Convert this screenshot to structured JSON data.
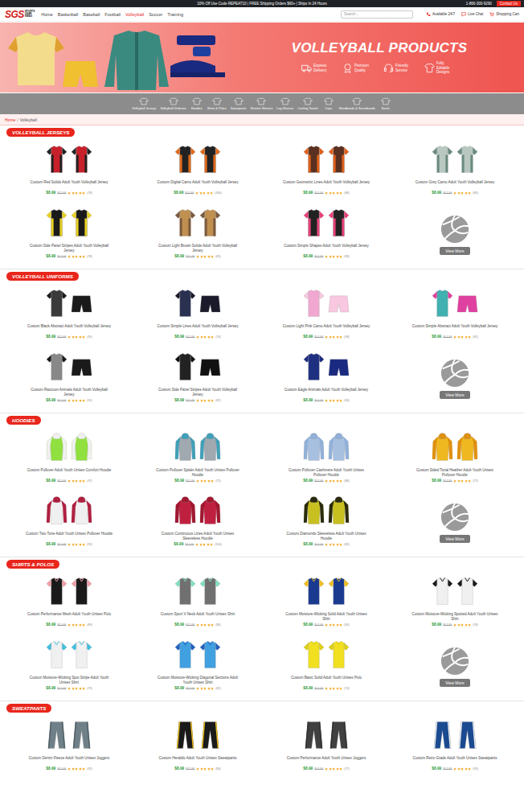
{
  "promo_bar": {
    "message": "10% Off Use Code REPEAT10 | FREE Shipping Orders $60+ | Ships In 24 Hours",
    "phone": "1-866-300-9290",
    "contact": "Contact Us"
  },
  "header": {
    "logo": "SGS",
    "logo_sub": [
      "SPORTS",
      "GEAR",
      "SWAG"
    ],
    "nav": [
      {
        "label": "Home",
        "selected": false
      },
      {
        "label": "Basketball",
        "selected": false
      },
      {
        "label": "Baseball",
        "selected": false
      },
      {
        "label": "Football",
        "selected": false
      },
      {
        "label": "Volleyball",
        "selected": true
      },
      {
        "label": "Soccer",
        "selected": false
      },
      {
        "label": "Training",
        "selected": false
      }
    ],
    "search": {
      "placeholder": "Search..."
    },
    "actions": [
      {
        "label": "Available 24/7",
        "kind": "phone"
      },
      {
        "label": "Live Chat",
        "kind": "chat"
      },
      {
        "label": "Shopping Cart",
        "kind": "cart"
      }
    ]
  },
  "banner": {
    "title": "VOLLEYBALL PRODUCTS",
    "features": [
      {
        "label": "Express Delivery",
        "kind": "truck"
      },
      {
        "label": "Premium Quality",
        "kind": "medal"
      },
      {
        "label": "Friendly Service",
        "kind": "headset"
      },
      {
        "label": "Fully Editable Designs",
        "kind": "shirt"
      }
    ]
  },
  "categories": [
    "Volleyball Jerseys",
    "Volleyball Uniforms",
    "Hoodies",
    "Shirts & Polos",
    "Sweatpants",
    "Shooter Sleeves",
    "Leg Sleeves",
    "Cooling Towels",
    "Caps",
    "Headbands & Sweatbands",
    "Socks"
  ],
  "breadcrumb": {
    "items": [
      "Home",
      "Volleyball"
    ],
    "separator": "/"
  },
  "sections": [
    {
      "title": "VOLLEYBALL JERSEYS",
      "kind": "jersey",
      "view_more": "View More",
      "products": [
        {
          "name": "Custom Red Solids Adult Youth Volleyball Jersey",
          "price": "$8.99",
          "old_price": "$17.99",
          "stars": 5,
          "reviews": "(78)",
          "color": "#c8202a",
          "trim": "#222222"
        },
        {
          "name": "Custom Digital Camo Adult Youth Volleyball Jersey",
          "price": "$8.99",
          "old_price": "$17.99",
          "stars": 5,
          "reviews": "(160)",
          "color": "#222222",
          "trim": "#e06a1a"
        },
        {
          "name": "Custom Geometric Lines Adult Youth Volleyball Jersey",
          "price": "$8.99",
          "old_price": "$17.99",
          "stars": 5,
          "reviews": "(88)",
          "color": "#5a3020",
          "trim": "#e0601a"
        },
        {
          "name": "Custom Grey Camo Adult Youth Volleyball Jersey",
          "price": "$8.99",
          "old_price": "$17.99",
          "stars": 5,
          "reviews": "(84)",
          "color": "#b8c8c0",
          "trim": "#6a8a80"
        },
        {
          "name": "Custom Side Panel Stripes Adult Youth Volleyball Jersey",
          "price": "$8.99",
          "old_price": "$17.99",
          "stars": 5,
          "reviews": "(78)",
          "color": "#1a1a1a",
          "trim": "#e8d020"
        },
        {
          "name": "Custom Light Brown Solids Adult Youth Volleyball Jersey",
          "price": "$8.99",
          "old_price": "$17.99",
          "stars": 5,
          "reviews": "(85)",
          "color": "#c09050",
          "trim": "#7a5a40"
        },
        {
          "name": "Custom Simple Shapes Adult Youth Volleyball Jersey",
          "price": "$8.99",
          "old_price": "$17.99",
          "stars": 5,
          "reviews": "(98)",
          "color": "#222222",
          "trim": "#e8407a"
        }
      ]
    },
    {
      "title": "VOLLEYBALL UNIFORMS",
      "kind": "uniform",
      "view_more": "View More",
      "products": [
        {
          "name": "Custom Black Abstract Adult Youth Volleyball Jersey",
          "price": "$8.99",
          "old_price": "$17.99",
          "stars": 5,
          "reviews": "(95)",
          "color": "#3a3a3a",
          "trim": "#1a1a1a"
        },
        {
          "name": "Custom Simple Lines Adult Youth Volleyball Jersey",
          "price": "$8.99",
          "old_price": "$17.99",
          "stars": 5,
          "reviews": "(70)",
          "color": "#2a3050",
          "trim": "#1a1a2a"
        },
        {
          "name": "Custom Light Pink Camo Adult Youth Volleyball Jersey",
          "price": "$8.99",
          "old_price": "$17.99",
          "stars": 5,
          "reviews": "(98)",
          "color": "#f0a8d0",
          "trim": "#f8c8e0"
        },
        {
          "name": "Custom Simple Abstract Adult Youth Volleyball Jersey",
          "price": "$8.99",
          "old_price": "$17.99",
          "stars": 5,
          "reviews": "(81)",
          "color": "#40b0b0",
          "trim": "#e040a0"
        },
        {
          "name": "Custom Raccoon Animals Adult Youth Volleyball Jersey",
          "price": "$8.99",
          "old_price": "$17.99",
          "stars": 5,
          "reviews": "(91)",
          "color": "#888888",
          "trim": "#1a1a1a"
        },
        {
          "name": "Custom Side Panel Stripes Adult Youth Volleyball Jersey",
          "price": "$8.99",
          "old_price": "$17.99",
          "stars": 5,
          "reviews": "(87)",
          "color": "#222222",
          "trim": "#111111"
        },
        {
          "name": "Custom Eagle Animals Adult Youth Volleyball Jersey",
          "price": "$8.99",
          "old_price": "$17.99",
          "stars": 5,
          "reviews": "(96)",
          "color": "#203080",
          "trim": "#1a2a80"
        }
      ]
    },
    {
      "title": "HOODIES",
      "kind": "hoodie",
      "view_more": "View More",
      "products": [
        {
          "name": "Custom Pullover Adult Youth Unisex Comfort Hoodie",
          "price": "$8.99",
          "old_price": "$17.99",
          "stars": 5,
          "reviews": "(97)",
          "color": "#90e040",
          "trim": "#f0f0f0"
        },
        {
          "name": "Custom Pullover Spider Adult Youth Unisex Pullover Hoodie",
          "price": "$8.99",
          "old_price": "$17.99",
          "stars": 5,
          "reviews": "(75)",
          "color": "#a0a8b0",
          "trim": "#40a0b8"
        },
        {
          "name": "Custom Pullover Cashmere Adult Youth Unisex Pullover Hoodie",
          "price": "$8.99",
          "old_price": "$17.99",
          "stars": 5,
          "reviews": "(88)",
          "color": "#a8c0e0",
          "trim": "#90b0d8"
        },
        {
          "name": "Custom Sided Tonal Heather Adult Youth Unisex Pullover Hoodie",
          "price": "$8.99",
          "old_price": "$17.99",
          "stars": 5,
          "reviews": "(71)",
          "color": "#f0b820",
          "trim": "#e09010"
        },
        {
          "name": "Custom Two-Tone Adult Youth Unisex Pullover Hoodie",
          "price": "$8.99",
          "old_price": "$17.99",
          "stars": 5,
          "reviews": "(95)",
          "color": "#f0f0f0",
          "trim": "#b02040"
        },
        {
          "name": "Custom Continuous Lines Adult Youth Unisex Sleeveless Hoodie",
          "price": "$8.99",
          "old_price": "$17.99",
          "stars": 5,
          "reviews": "(104)",
          "color": "#c02040",
          "trim": "#a01830"
        },
        {
          "name": "Custom Diamonds Sleeveless Adult Youth Unisex Hoodie",
          "price": "$8.99",
          "old_price": "$17.99",
          "stars": 5,
          "reviews": "(83)",
          "color": "#c8c020",
          "trim": "#2a2a10"
        }
      ]
    },
    {
      "title": "SHIRTS & POLOS",
      "kind": "shirt",
      "view_more": "View More",
      "products": [
        {
          "name": "Custom Performance Mesh Adult Youth Unisex Polo",
          "price": "$8.99",
          "old_price": "$17.99",
          "stars": 5,
          "reviews": "(89)",
          "color": "#1a1a1a",
          "trim": "#f0a0a8"
        },
        {
          "name": "Custom Sport V Neck Adult Youth Unisex Shirt",
          "price": "$8.99",
          "old_price": "$17.99",
          "stars": 5,
          "reviews": "(86)",
          "color": "#707070",
          "trim": "#80e0c0"
        },
        {
          "name": "Custom Moisture-Wicking Solid Adult Youth Unisex Shirt",
          "price": "$8.99",
          "old_price": "$17.99",
          "stars": 5,
          "reviews": "(90)",
          "color": "#1a3a90",
          "trim": "#f0c020"
        },
        {
          "name": "Custom Moisture-Wicking Spotted Adult Youth Unisex Shirt",
          "price": "$8.99",
          "old_price": "$17.99",
          "stars": 5,
          "reviews": "(78)",
          "color": "#f0f0f0",
          "trim": "#1a1a1a"
        },
        {
          "name": "Custom Moisture-Wicking Spot Stripe Adult Youth Unisex Shirt",
          "price": "$8.99",
          "old_price": "$17.99",
          "stars": 5,
          "reviews": "(79)",
          "color": "#f0f0f0",
          "trim": "#40c0e0"
        },
        {
          "name": "Custom Moisture-Wicking Diagonal Sections Adult Youth Unisex Shirt",
          "price": "$8.99",
          "old_price": "$17.99",
          "stars": 5,
          "reviews": "(82)",
          "color": "#40a0e0",
          "trim": "#2060c0"
        },
        {
          "name": "Custom Basic Solid Adult Youth Unisex Polo",
          "price": "$8.99",
          "old_price": "$17.99",
          "stars": 5,
          "reviews": "(74)",
          "color": "#f0e020",
          "trim": "#e0d010"
        }
      ]
    },
    {
      "title": "SWEATPANTS",
      "kind": "pants",
      "view_more": "",
      "products": [
        {
          "name": "Custom Denim Fleece Adult Youth Unisex Joggers",
          "price": "$8.99",
          "old_price": "$17.99",
          "stars": 5,
          "reviews": "(92)",
          "color": "#708088",
          "trim": "#506068"
        },
        {
          "name": "Custom Heraldic Adult Youth Unisex Sweatpants",
          "price": "$8.99",
          "old_price": "$17.99",
          "stars": 5,
          "reviews": "(80)",
          "color": "#1a1a1a",
          "trim": "#f0c020"
        },
        {
          "name": "Custom Performance Adult Youth Unisex Joggers",
          "price": "$8.99",
          "old_price": "$17.99",
          "stars": 5,
          "reviews": "(77)",
          "color": "#404040",
          "trim": "#303030"
        },
        {
          "name": "Custom Retro Grade Adult Youth Unisex Sweatpants",
          "price": "$8.99",
          "old_price": "$17.99",
          "stars": 5,
          "reviews": "(93)",
          "color": "#1a4a90",
          "trim": "#f0f0f0"
        }
      ]
    }
  ]
}
